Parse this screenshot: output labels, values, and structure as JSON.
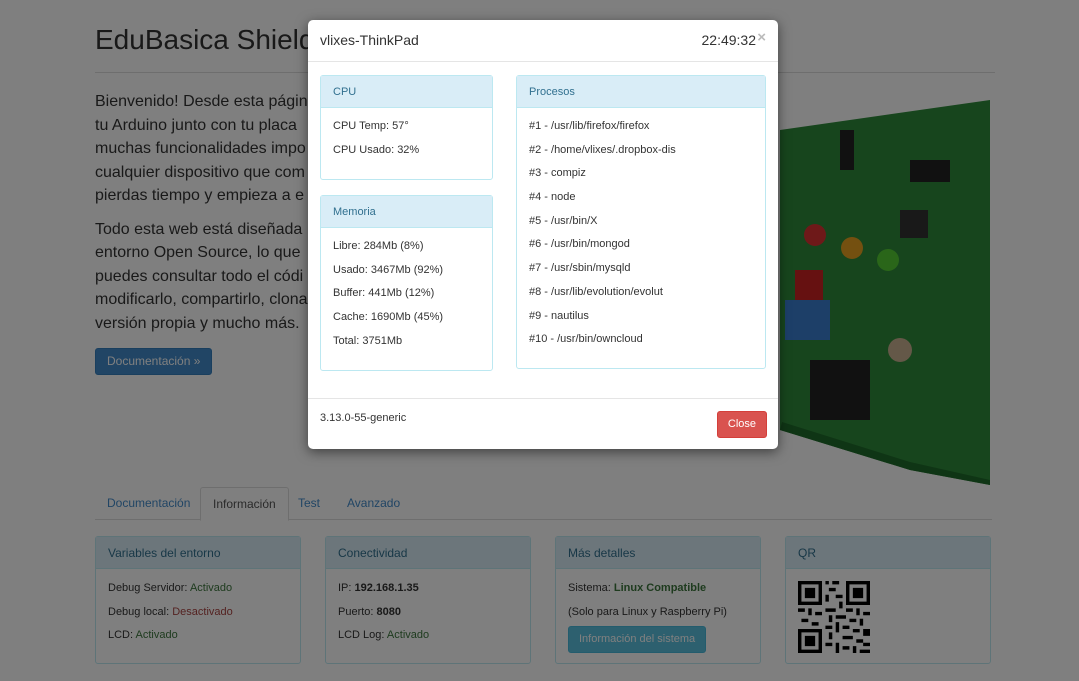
{
  "page": {
    "title": "EduBasica Shield",
    "intro_lines_1": [
      "Bienvenido! Desde esta página",
      "tu Arduino junto con tu placa",
      "muchas funcionalidades impo",
      "cualquier dispositivo que com",
      "pierdas tiempo y empieza a e"
    ],
    "intro_lines_2": [
      "Todo esta web está diseñada",
      "entorno Open Source, lo que",
      "puedes consultar todo el códi",
      "modificarlo, compartirlo, clona",
      "versión propia y mucho más."
    ],
    "doc_button": "Documentación »"
  },
  "tabs": [
    "Documentación",
    "Información",
    "Test",
    "Avanzado"
  ],
  "panels": {
    "env": {
      "title": "Variables del entorno",
      "rows": [
        {
          "label": "Debug Servidor: ",
          "value": "Activado"
        },
        {
          "label": "Debug local: ",
          "value": "Desactivado"
        },
        {
          "label": "LCD: ",
          "value": "Activado"
        }
      ]
    },
    "conn": {
      "title": "Conectividad",
      "rows": [
        {
          "label": "IP: ",
          "value": "192.168.1.35"
        },
        {
          "label": "Puerto: ",
          "value": "8080"
        },
        {
          "label": "LCD Log: ",
          "value": "Activado"
        }
      ]
    },
    "details": {
      "title": "Más detalles",
      "system_label": "Sistema: ",
      "system_value": "Linux Compatible",
      "note": "(Solo para Linux y Raspberry Pi)",
      "button": "Información del sistema"
    },
    "qr": {
      "title": "QR"
    }
  },
  "modal": {
    "title": "vlixes-ThinkPad",
    "time": "22:49:32",
    "close_x": "×",
    "cpu": {
      "title": "CPU",
      "rows": [
        "CPU Temp: 57°",
        "CPU Usado: 32%"
      ]
    },
    "memory": {
      "title": "Memoria",
      "rows": [
        "Libre: 284Mb (8%)",
        "Usado: 3467Mb (92%)",
        "Buffer: 441Mb (12%)",
        "Cache: 1690Mb (45%)",
        "Total: 3751Mb"
      ]
    },
    "processes": {
      "title": "Procesos",
      "rows": [
        "#1 - /usr/lib/firefox/firefox",
        "#2 - /home/vlixes/.dropbox-dis",
        "#3 - compiz",
        "#4 - node",
        "#5 - /usr/bin/X",
        "#6 - /usr/bin/mongod",
        "#7 - /usr/sbin/mysqld",
        "#8 - /usr/lib/evolution/evolut",
        "#9 - nautilus",
        "#10 - /usr/bin/owncloud"
      ]
    },
    "kernel": "3.13.0-55-generic",
    "close_button": "Close"
  }
}
